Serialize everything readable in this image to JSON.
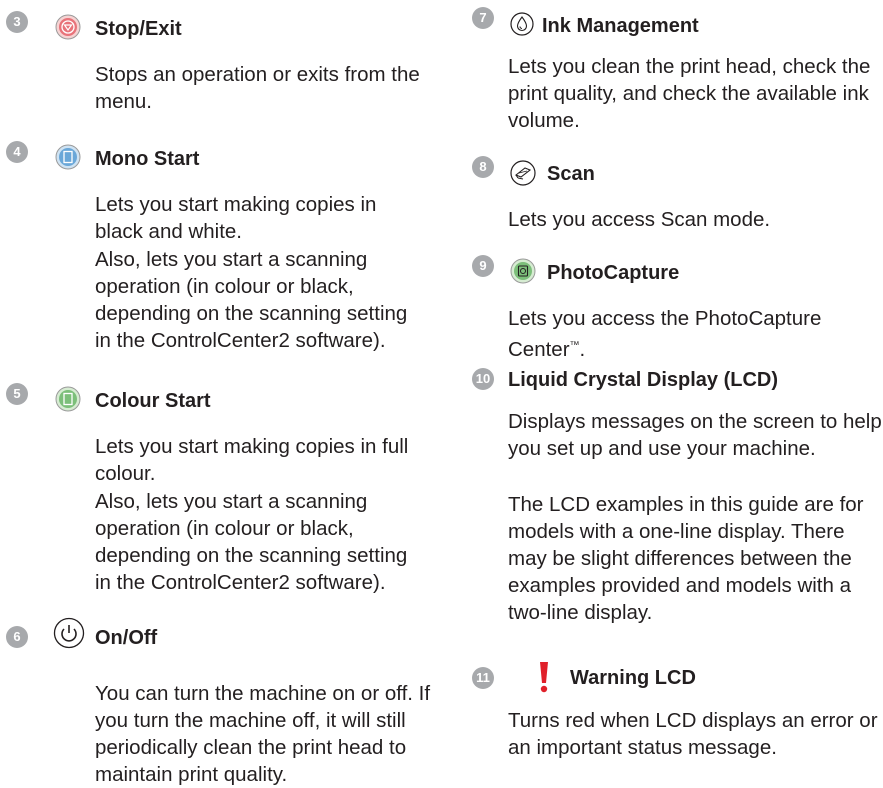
{
  "left": {
    "items": [
      {
        "number": "3",
        "icon": "stop-exit-icon",
        "title": "Stop/Exit",
        "paragraphs": [
          "Stops an operation or exits from the menu."
        ]
      },
      {
        "number": "4",
        "icon": "mono-start-icon",
        "title": "Mono Start",
        "paragraphs": [
          "Lets you start making copies in black and white.",
          "Also, lets you start a scanning operation (in colour or black, depending on the scanning setting in the ControlCenter2 software)."
        ]
      },
      {
        "number": "5",
        "icon": "colour-start-icon",
        "title": "Colour Start",
        "paragraphs": [
          "Lets you start making copies in full colour.",
          "Also, lets you start a scanning operation (in colour or black, depending on the scanning setting in the ControlCenter2 software)."
        ]
      },
      {
        "number": "6",
        "icon": "power-icon",
        "title": "On/Off",
        "paragraphs": [
          "You can turn the machine on or off. If you turn the machine off, it will still periodically clean the print head to maintain print quality."
        ]
      }
    ]
  },
  "right": {
    "items": [
      {
        "number": "7",
        "icon": "ink-drop-icon",
        "title": "Ink Management",
        "paragraphs": [
          "Lets you clean the print head, check the print quality, and check the available ink volume."
        ]
      },
      {
        "number": "8",
        "icon": "scan-icon",
        "title": "Scan",
        "paragraphs": [
          "Lets you access Scan mode."
        ]
      },
      {
        "number": "9",
        "icon": "photocapture-icon",
        "title": "PhotoCapture",
        "paragraphs": [
          "Lets you access the PhotoCapture Center"
        ],
        "trademark": "™",
        "suffix": "."
      },
      {
        "number": "10",
        "title": "Liquid Crystal Display (LCD)",
        "paragraphs": [
          "Displays messages on the screen to help you set up and use your machine.",
          "The LCD examples in this guide are for models with a one-line display. There may be slight differences between the examples provided and models with a two-line display."
        ]
      },
      {
        "number": "11",
        "icon": "warning-icon",
        "title": "Warning LCD",
        "paragraphs": [
          "Turns red when LCD displays an error or an important status message."
        ]
      }
    ]
  }
}
